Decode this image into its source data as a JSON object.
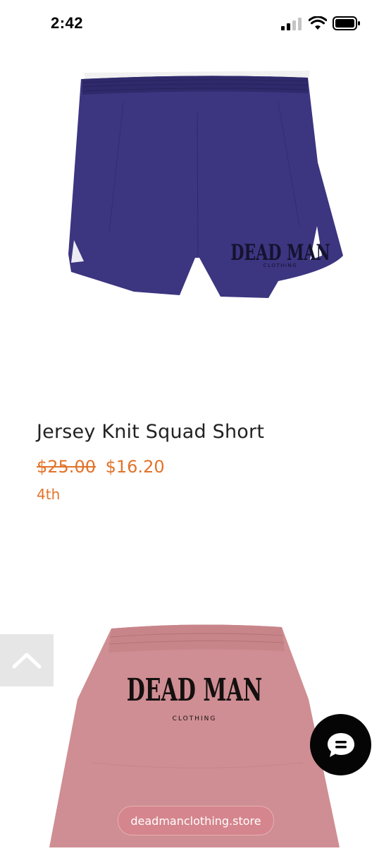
{
  "status_bar": {
    "time": "2:42"
  },
  "products": [
    {
      "name": "Jersey Knit Squad Short",
      "original_price": "$25.00",
      "sale_price": "$16.20",
      "variant": "4th",
      "color": "#3c3580",
      "logo_text": "DEAD MAN",
      "logo_subtext": "CLOTHING"
    },
    {
      "color": "#cf8e93",
      "logo_text": "DEAD MAN",
      "logo_subtext": "CLOTHING"
    }
  ],
  "url_bar": {
    "domain": "deadmanclothing.store"
  },
  "icons": {
    "back_to_top": "chevron-up-icon",
    "chat": "chat-bubble-icon",
    "signal": "cellular-signal-icon",
    "wifi": "wifi-icon",
    "battery": "battery-icon"
  },
  "colors": {
    "price": "#e2732a",
    "chat_bg": "#050505",
    "pill_bg": "#d6848c"
  }
}
